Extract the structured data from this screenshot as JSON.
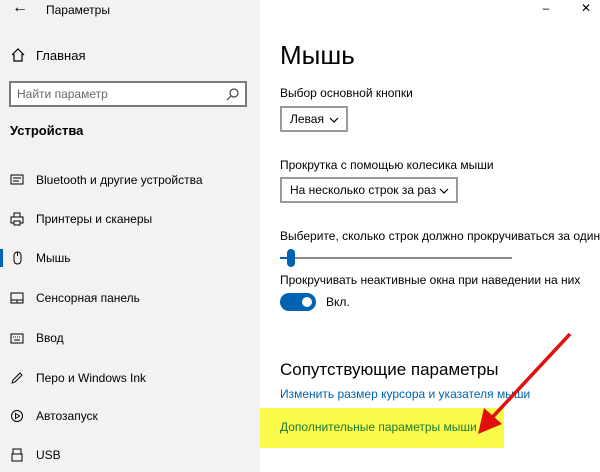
{
  "window": {
    "title": "Параметры",
    "minimize_glyph": "–",
    "close_glyph": "✕",
    "back_glyph": "←"
  },
  "sidebar": {
    "home_label": "Главная",
    "search_placeholder": "Найти параметр",
    "section_title": "Устройства",
    "items": [
      {
        "label": "Bluetooth и другие устройства",
        "icon": "bluetooth-icon"
      },
      {
        "label": "Принтеры и сканеры",
        "icon": "printer-icon"
      },
      {
        "label": "Мышь",
        "icon": "mouse-icon",
        "active": true
      },
      {
        "label": "Сенсорная панель",
        "icon": "touchpad-icon"
      },
      {
        "label": "Ввод",
        "icon": "keyboard-icon"
      },
      {
        "label": "Перо и Windows Ink",
        "icon": "pen-icon"
      },
      {
        "label": "Автозапуск",
        "icon": "autoplay-icon"
      },
      {
        "label": "USB",
        "icon": "usb-icon"
      }
    ]
  },
  "main": {
    "title": "Мышь",
    "primary_button_label": "Выбор основной кнопки",
    "primary_button_value": "Левая",
    "scroll_label": "Прокрутка с помощью колесика мыши",
    "scroll_value": "На несколько строк за раз",
    "lines_label": "Выберите, сколько строк должно прокручиваться за один раз",
    "lines_slider_fraction": 0.03,
    "inactive_scroll_label": "Прокручивать неактивные окна при наведении на них",
    "inactive_scroll_state": "Вкл.",
    "related_title": "Сопутствующие параметры",
    "link_cursor": "Изменить размер курсора и указателя мыши",
    "link_additional": "Дополнительные параметры мыши"
  },
  "colors": {
    "accent": "#0063b1",
    "highlight": "#fbfb4b",
    "arrow": "#e01010",
    "sidebar_bg": "#f2f2f2"
  }
}
